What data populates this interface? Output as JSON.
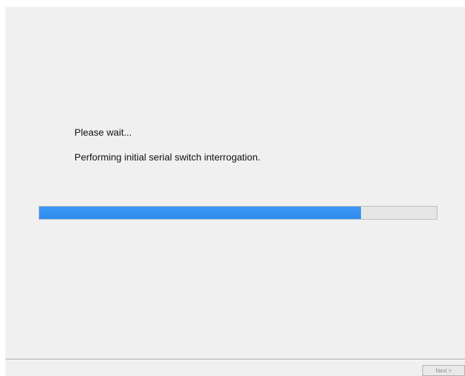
{
  "dialog": {
    "wait_text": "Please wait...",
    "status_text": "Performing initial serial switch interrogation.",
    "progress_fraction": 0.81
  },
  "footer": {
    "next_label": "Next >"
  },
  "colors": {
    "progress_fill": "#3d98f5",
    "dialog_background": "#f0f0f0"
  }
}
